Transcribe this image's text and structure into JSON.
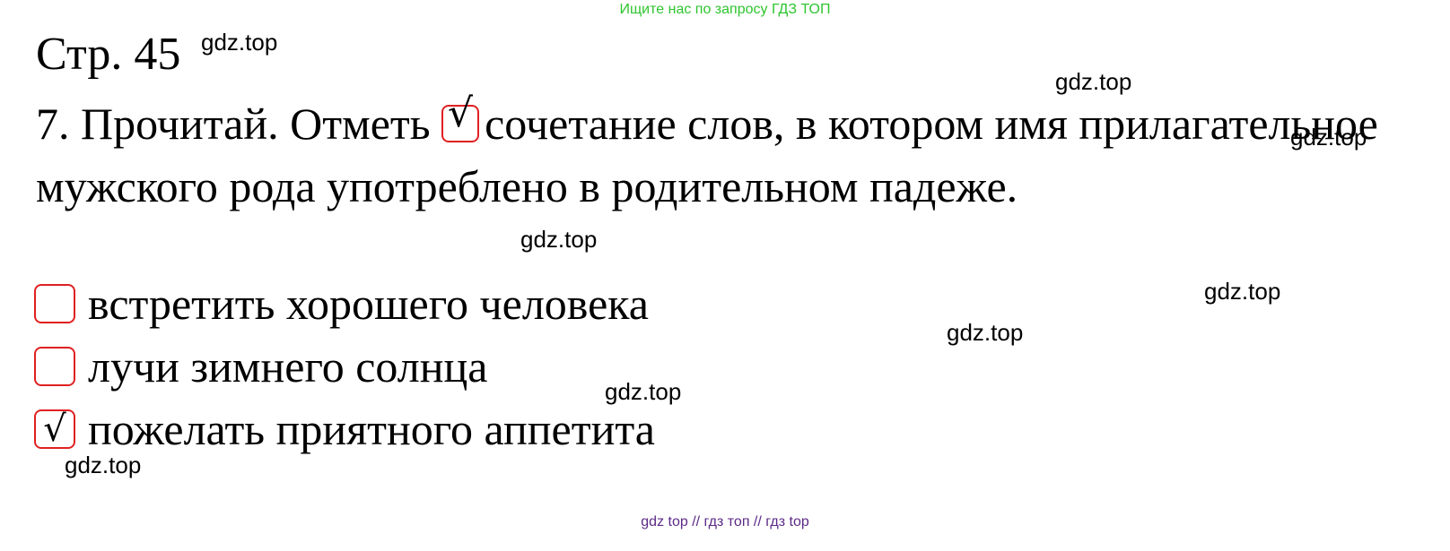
{
  "top_banner": "Ищите нас по запросу ГДЗ ТОП",
  "page_ref": "Стр. 45",
  "task": {
    "part1": "7. Прочитай. Отметь",
    "check_mark": "√",
    "part2": "сочетание слов, в котором имя прилагательное мужского рода употреблено в родительном падеже."
  },
  "options": [
    {
      "text": "встретить хорошего человека",
      "checked": false,
      "mark": ""
    },
    {
      "text": "лучи зимнего солнца",
      "checked": false,
      "mark": ""
    },
    {
      "text": "пожелать приятного аппетита",
      "checked": true,
      "mark": "√"
    }
  ],
  "watermark": "gdz.top",
  "footer": "gdz top  //  гдз топ  //  гдз top",
  "colors": {
    "box_border": "#e02020",
    "banner": "#2fc52f",
    "footer": "#5b2a86"
  }
}
